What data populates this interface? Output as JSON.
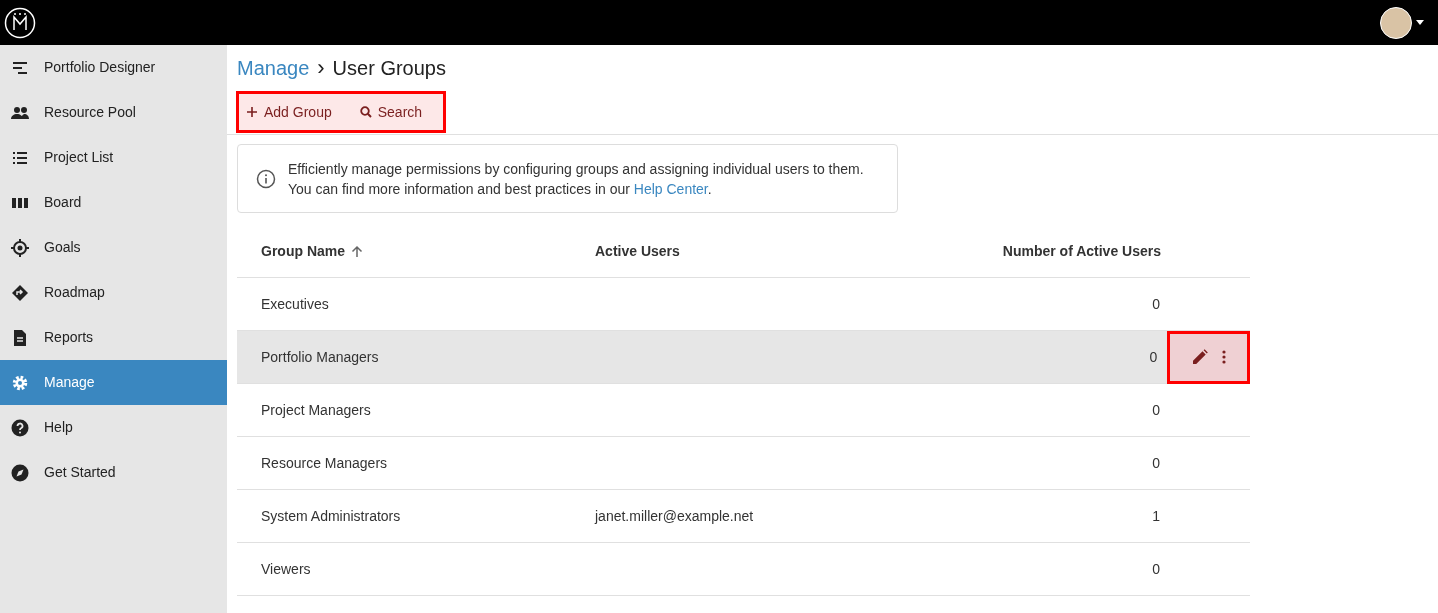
{
  "sidebar": {
    "items": [
      {
        "label": "Portfolio Designer",
        "kind": "designer",
        "selected": false
      },
      {
        "label": "Resource Pool",
        "kind": "people",
        "selected": false
      },
      {
        "label": "Project List",
        "kind": "list",
        "selected": false
      },
      {
        "label": "Board",
        "kind": "board",
        "selected": false
      },
      {
        "label": "Goals",
        "kind": "target",
        "selected": false
      },
      {
        "label": "Roadmap",
        "kind": "roadmap",
        "selected": false
      },
      {
        "label": "Reports",
        "kind": "report",
        "selected": false
      },
      {
        "label": "Manage",
        "kind": "gear",
        "selected": true
      },
      {
        "label": "Help",
        "kind": "help",
        "selected": false
      },
      {
        "label": "Get Started",
        "kind": "compass",
        "selected": false
      }
    ]
  },
  "breadcrumb": {
    "parent": "Manage",
    "separator": "›",
    "current": "User Groups"
  },
  "toolbar": {
    "highlighted": true,
    "buttons": [
      {
        "label": "Add Group",
        "kind": "plus"
      },
      {
        "label": "Search",
        "kind": "search"
      }
    ]
  },
  "info": {
    "text": "Efficiently manage permissions by configuring groups and assigning individual users to them.\nYou can find more information and best practices in our ",
    "link": "Help Center",
    "after": "."
  },
  "table": {
    "columns": [
      "Group Name",
      "Active Users",
      "Number of Active Users"
    ],
    "sort_ascending": true,
    "rows": [
      {
        "cells": [
          "Executives",
          "",
          "0"
        ],
        "selected": false
      },
      {
        "cells": [
          "Portfolio Managers",
          "",
          "0"
        ],
        "selected": true,
        "actions_highlighted": true
      },
      {
        "cells": [
          "Project Managers",
          "",
          "0"
        ],
        "selected": false
      },
      {
        "cells": [
          "Resource Managers",
          "",
          "0"
        ],
        "selected": false
      },
      {
        "cells": [
          "System Administrators",
          "janet.miller@example.net",
          "1"
        ],
        "selected": false
      },
      {
        "cells": [
          "Viewers",
          "",
          "0"
        ],
        "selected": false
      }
    ]
  }
}
